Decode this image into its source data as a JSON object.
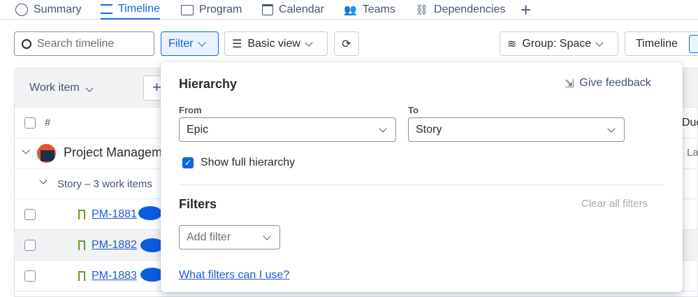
{
  "tabs": [
    {
      "label": "Summary",
      "icon": "globe-icon"
    },
    {
      "label": "Timeline",
      "icon": "timeline-icon",
      "active": true
    },
    {
      "label": "Program",
      "icon": "columns-icon"
    },
    {
      "label": "Calendar",
      "icon": "calendar-icon"
    },
    {
      "label": "Teams",
      "icon": "people-icon"
    },
    {
      "label": "Dependencies",
      "icon": "dependencies-icon"
    }
  ],
  "toolbar": {
    "search_placeholder": "Search timeline",
    "filter": "Filter",
    "basic_view": "Basic view",
    "group": "Group: Space",
    "timeline": "Timeline"
  },
  "table": {
    "work_item": "Work item",
    "hash": "#",
    "project": "Project Managem",
    "group": "Story – 3 work items",
    "rows": [
      "PM-1881",
      "PM-1882",
      "PM-1883"
    ],
    "due_col": "Due",
    "cell_partial": "La"
  },
  "popover": {
    "hierarchy": "Hierarchy",
    "feedback": "Give feedback",
    "from_label": "From",
    "from_value": "Epic",
    "to_label": "To",
    "to_value": "Story",
    "show_full": "Show full hierarchy",
    "filters": "Filters",
    "clear": "Clear all filters",
    "add_filter": "Add filter",
    "help_link": "What filters can I use?"
  },
  "colors": {
    "accent": "#0c66e4",
    "redaction": "#0b5be0"
  }
}
